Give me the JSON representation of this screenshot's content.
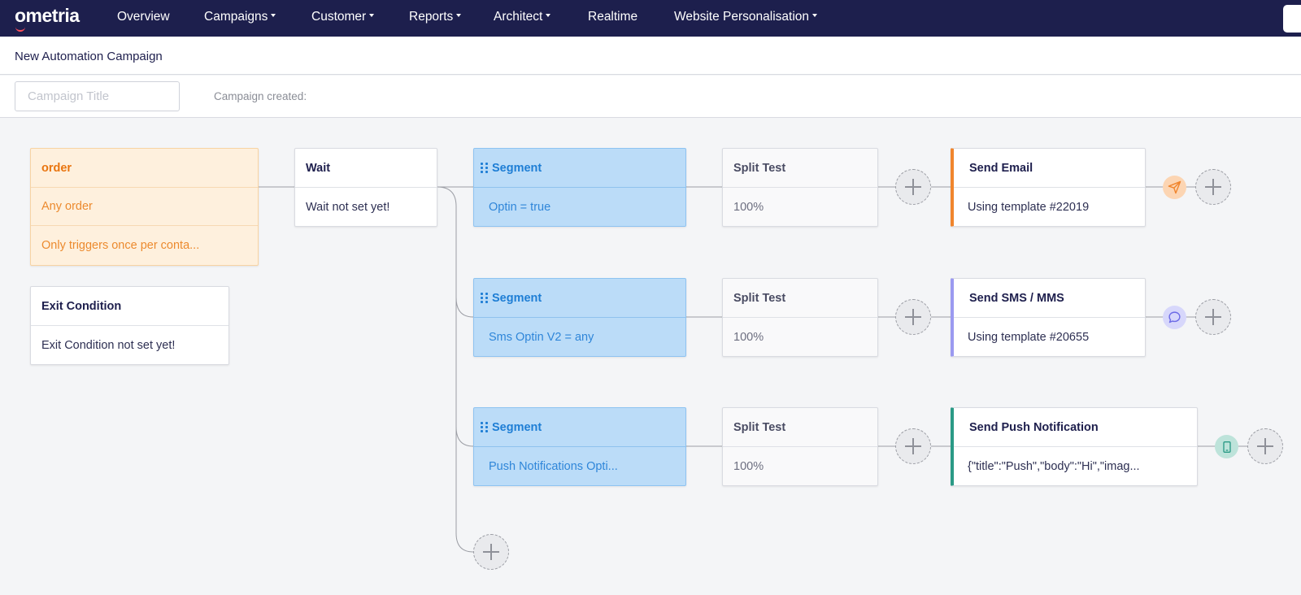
{
  "nav": {
    "logo": "ometria",
    "items": [
      {
        "label": "Overview",
        "dropdown": false
      },
      {
        "label": "Campaigns",
        "dropdown": true
      },
      {
        "label": "Customer",
        "dropdown": true
      },
      {
        "label": "Reports",
        "dropdown": true
      },
      {
        "label": "Architect",
        "dropdown": true
      },
      {
        "label": "Realtime",
        "dropdown": false
      },
      {
        "label": "Website Personalisation",
        "dropdown": true
      }
    ]
  },
  "page": {
    "title": "New Automation Campaign",
    "campaign_title_placeholder": "Campaign Title",
    "campaign_title_value": "",
    "campaign_created_label": "Campaign created:"
  },
  "trigger": {
    "title": "order",
    "rows": [
      "Any order",
      "Only triggers once per conta..."
    ]
  },
  "exit_condition": {
    "title": "Exit Condition",
    "text": "Exit Condition not set yet!"
  },
  "wait": {
    "title": "Wait",
    "text": "Wait not set yet!"
  },
  "branches": [
    {
      "segment": {
        "title": "Segment",
        "text": "Optin = true"
      },
      "split": {
        "title": "Split Test",
        "text": "100%"
      },
      "action": {
        "title": "Send Email",
        "text": "Using template #22019",
        "accent": "#f0852d",
        "icon": "paper-plane-icon"
      }
    },
    {
      "segment": {
        "title": "Segment",
        "text": "Sms Optin V2 = any"
      },
      "split": {
        "title": "Split Test",
        "text": "100%"
      },
      "action": {
        "title": "Send SMS / MMS",
        "text": "Using template #20655",
        "accent": "#9b9af0",
        "icon": "chat-bubble-icon"
      }
    },
    {
      "segment": {
        "title": "Segment",
        "text": "Push Notifications Opti..."
      },
      "split": {
        "title": "Split Test",
        "text": "100%"
      },
      "action": {
        "title": "Send Push Notification",
        "text": "{\"title\":\"Push\",\"body\":\"Hi\",\"imag...",
        "accent": "#2a9a86",
        "icon": "mobile-phone-icon"
      }
    }
  ],
  "colors": {
    "nav_bg": "#1d1f4d",
    "trigger_bg": "#fef0dd",
    "trigger_text": "#e9750f",
    "segment_bg": "#bbdcf8",
    "segment_text": "#1e7ed5"
  }
}
